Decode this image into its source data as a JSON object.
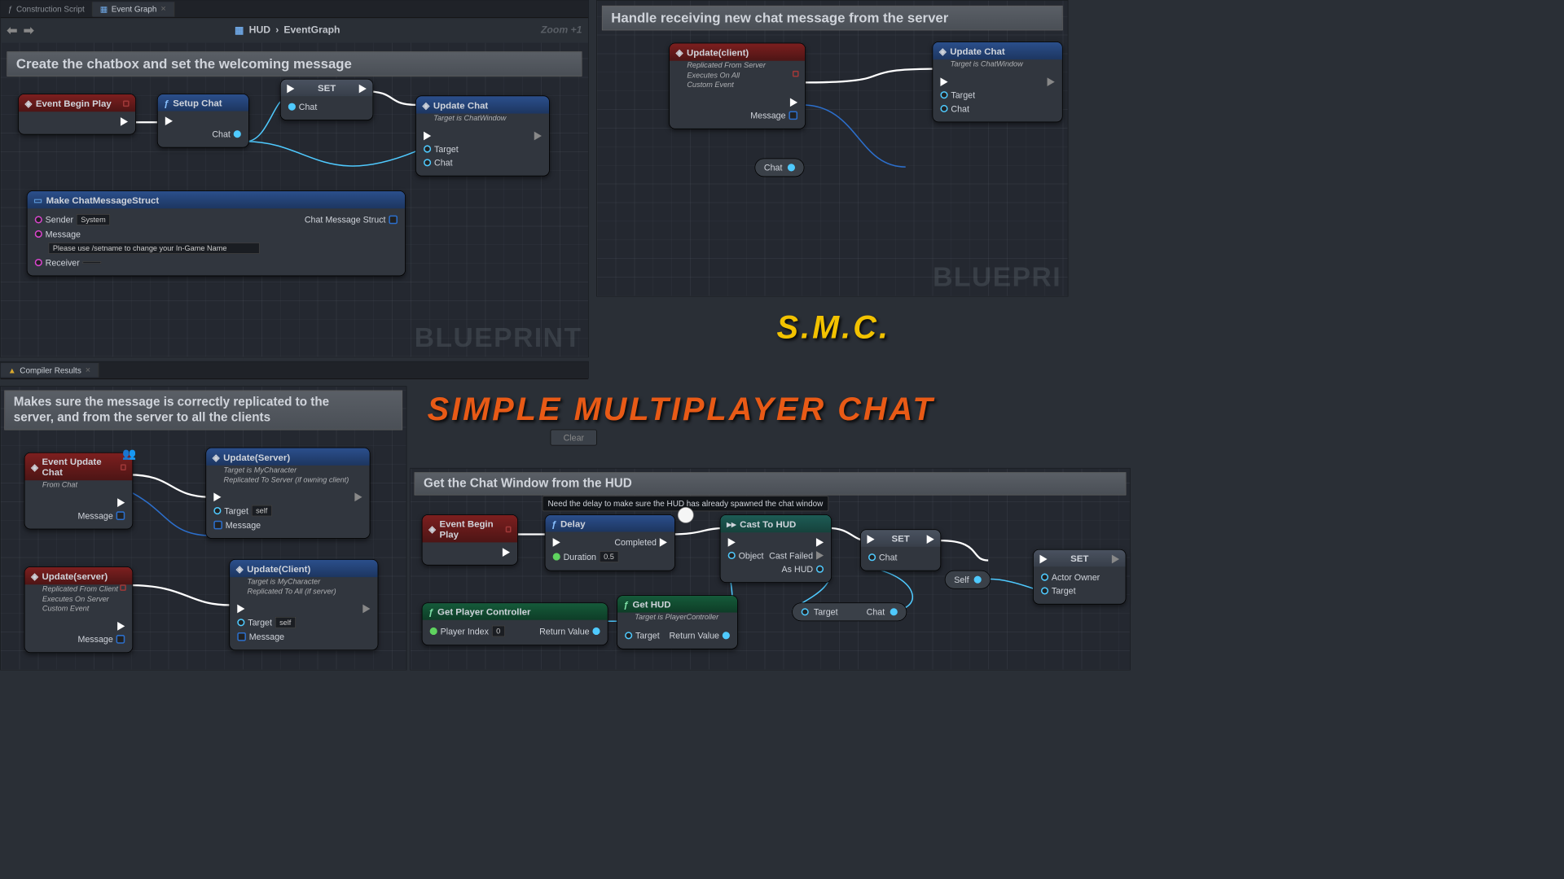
{
  "tabs": {
    "construction": "Construction Script",
    "eventgraph": "Event Graph"
  },
  "breadcrumb": {
    "hud": "HUD",
    "eg": "EventGraph",
    "sep": "›"
  },
  "zoom": "Zoom +1",
  "compiler_tab": "Compiler Results",
  "watermark": "BLUEPRINT",
  "watermark_clip": "BLUEPRI",
  "brand": {
    "short": "S.M.C.",
    "full": "SIMPLE MULTIPLAYER CHAT"
  },
  "sections": {
    "p1": "Create the chatbox and set the welcoming message",
    "p2": "Handle receiving new chat message from the server",
    "p3a": "Makes sure the message is correctly replicated to the",
    "p3b": "server, and from the server to all the clients",
    "p4": "Get the Chat Window from the HUD"
  },
  "labels": {
    "event_begin_play": "Event Begin Play",
    "setup_chat": "Setup Chat",
    "chat": "Chat",
    "set": "SET",
    "update_chat": "Update Chat",
    "target_chatwindow": "Target is ChatWindow",
    "target": "Target",
    "make_struct": "Make ChatMessageStruct",
    "sender": "Sender",
    "message": "Message",
    "receiver": "Receiver",
    "chat_msg_struct": "Chat Message Struct",
    "system": "System",
    "welcome_msg": "Please use /setname to change your In-Game Name",
    "update_client": "Update(client)",
    "rep_from_server": "Replicated From Server",
    "exec_all": "Executes On All",
    "custom_event": "Custom Event",
    "event_update_chat": "Event Update Chat",
    "from_chat": "From Chat",
    "update_server_f": "Update(Server)",
    "target_mychar": "Target is MyCharacter",
    "rep_to_server": "Replicated To Server (if owning client)",
    "self": "self",
    "update_server_e": "Update(server)",
    "rep_from_client": "Replicated From Client",
    "exec_server": "Executes On Server",
    "update_client_f": "Update(Client)",
    "rep_to_all": "Replicated To All (if server)",
    "delay": "Delay",
    "completed": "Completed",
    "duration": "Duration",
    "duration_val": "0.5",
    "cast_hud": "Cast To HUD",
    "object": "Object",
    "cast_failed": "Cast Failed",
    "as_hud": "As HUD",
    "get_pc": "Get Player Controller",
    "player_index": "Player Index",
    "pi_val": "0",
    "return_value": "Return Value",
    "get_hud": "Get HUD",
    "target_pc": "Target is PlayerController",
    "actor_owner": "Actor Owner",
    "tooltip": "Need the delay to make sure the HUD has already spawned the chat window",
    "clear": "Clear",
    "self_l": "Self"
  }
}
